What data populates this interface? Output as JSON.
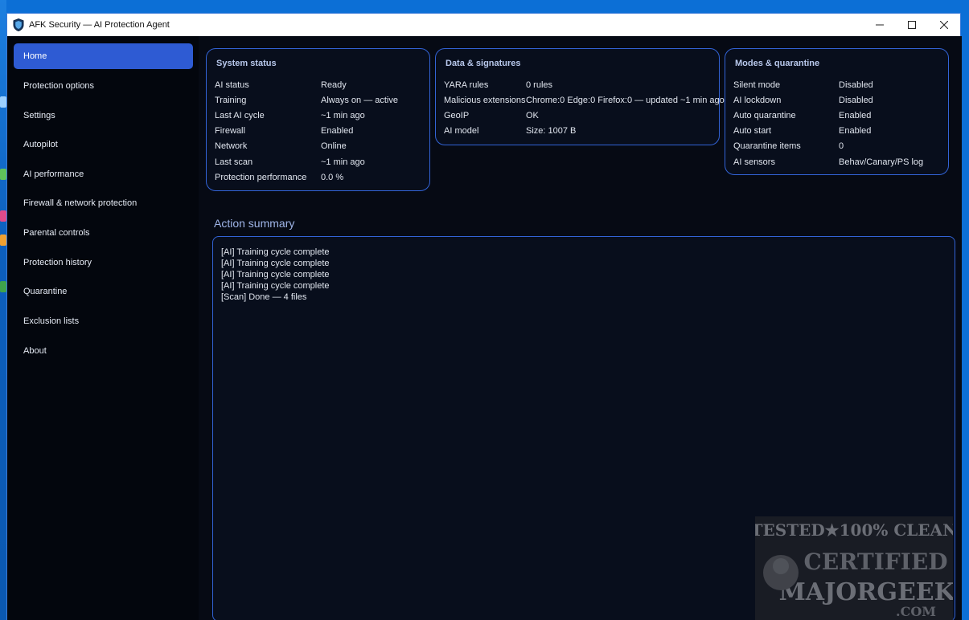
{
  "window": {
    "title": "AFK Security — AI Protection Agent"
  },
  "sidebar": {
    "items": [
      {
        "label": "Home",
        "active": true
      },
      {
        "label": "Protection options"
      },
      {
        "label": "Settings"
      },
      {
        "label": "Autopilot"
      },
      {
        "label": "AI performance"
      },
      {
        "label": "Firewall & network protection"
      },
      {
        "label": "Parental controls"
      },
      {
        "label": "Protection history"
      },
      {
        "label": "Quarantine"
      },
      {
        "label": "Exclusion lists"
      },
      {
        "label": "About"
      }
    ]
  },
  "system_status": {
    "title": "System status",
    "rows": [
      {
        "key": "AI status",
        "value": "Ready"
      },
      {
        "key": "Training",
        "value": "Always on — active"
      },
      {
        "key": "Last AI cycle",
        "value": "~1 min ago"
      },
      {
        "key": "Firewall",
        "value": "Enabled"
      },
      {
        "key": "Network",
        "value": "Online"
      },
      {
        "key": "Last scan",
        "value": "~1 min ago"
      },
      {
        "key": "Protection performance",
        "value": "0.0 %"
      }
    ]
  },
  "data_signatures": {
    "title": "Data & signatures",
    "rows": [
      {
        "key": "YARA rules",
        "value": "0 rules"
      },
      {
        "key": "Malicious extensions",
        "value": "Chrome:0 Edge:0 Firefox:0 — updated ~1 min ago"
      },
      {
        "key": "GeoIP",
        "value": "OK"
      },
      {
        "key": "AI model",
        "value": "Size: 1007 B"
      }
    ]
  },
  "modes_quarantine": {
    "title": "Modes & quarantine",
    "rows": [
      {
        "key": "Silent mode",
        "value": "Disabled"
      },
      {
        "key": "AI lockdown",
        "value": "Disabled"
      },
      {
        "key": "Auto quarantine",
        "value": "Enabled"
      },
      {
        "key": "Auto start",
        "value": "Enabled"
      },
      {
        "key": "Quarantine items",
        "value": "0"
      },
      {
        "key": "AI sensors",
        "value": "Behav/Canary/PS log"
      }
    ]
  },
  "action_summary": {
    "title": "Action summary",
    "lines": [
      "[AI] Training cycle complete",
      "[AI] Training cycle complete",
      "[AI] Training cycle complete",
      "[AI] Training cycle complete",
      "[Scan] Done — 4 files"
    ]
  },
  "watermark": {
    "line1": "TESTED★100% CLEAN",
    "line2": "CERTIFIED",
    "line3": "MAJORGEEKS",
    "line4": ".COM"
  },
  "colors": {
    "accent": "#2e5bd3",
    "card_border": "#3263d6",
    "background": "#060a14"
  }
}
